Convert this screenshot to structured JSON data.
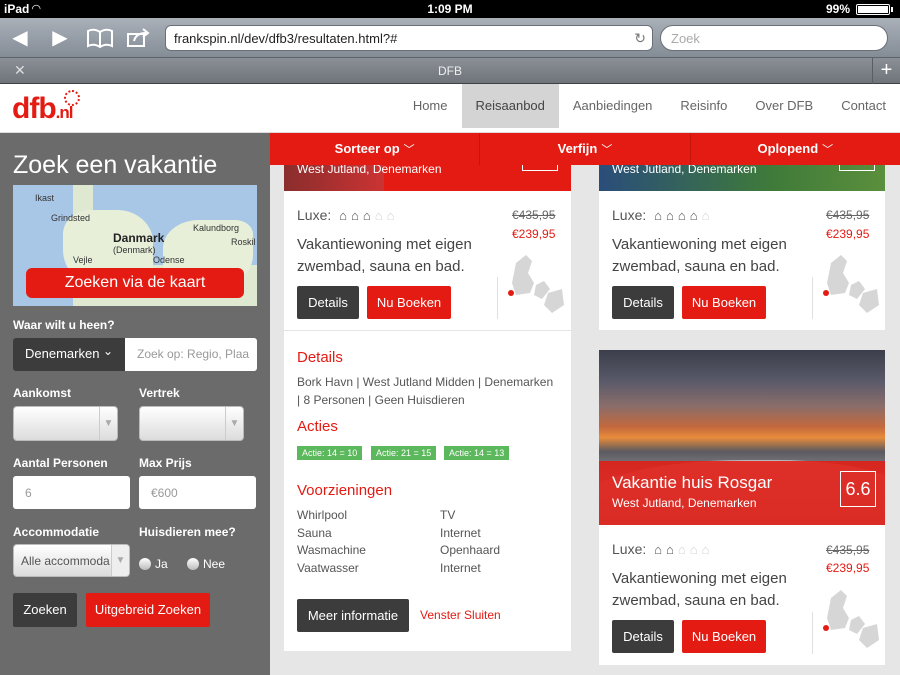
{
  "statusbar": {
    "carrier": "iPad",
    "time": "1:09 PM",
    "battery": "99%"
  },
  "browser": {
    "url": "frankspin.nl/dev/dfb3/resultaten.html?#",
    "search_placeholder": "Zoek",
    "tab_title": "DFB"
  },
  "site": {
    "logo_main": "dfb",
    "logo_tld": ".nl",
    "nav": [
      "Home",
      "Reisaanbod",
      "Aanbiedingen",
      "Reisinfo",
      "Over DFB",
      "Contact"
    ],
    "nav_active": "Reisaanbod"
  },
  "sidebar": {
    "title": "Zoek een vakantie",
    "map_labels": [
      "Grindsted",
      "Danmark",
      "(Denmark)",
      "Kalundborg",
      "Roskil",
      "Vejle",
      "Odense",
      "Ikast"
    ],
    "map_button": "Zoeken via de kaart",
    "where_label": "Waar wilt u heen?",
    "country_value": "Denemarken",
    "region_placeholder": "Zoek op: Regio, Plaa",
    "arrival_label": "Aankomst",
    "departure_label": "Vertrek",
    "persons_label": "Aantal Personen",
    "persons_placeholder": "6",
    "maxprice_label": "Max Prijs",
    "maxprice_placeholder": "€600",
    "accommodation_label": "Accommodatie",
    "accommodation_value": "Alle accommoda",
    "pets_label": "Huisdieren mee?",
    "pets_yes": "Ja",
    "pets_no": "Nee",
    "search_button": "Zoeken",
    "advanced_button": "Uitgebreid Zoeken"
  },
  "filters": [
    "Sorteer op",
    "Verfijn",
    "Oplopend"
  ],
  "cards": {
    "card1": {
      "location": "West Jutland, Denemarken",
      "luxe_label": "Luxe:",
      "luxe_rating": 3,
      "old_price": "€435,95",
      "new_price": "€239,95",
      "desc_line1": "Vakantiewoning met eigen",
      "desc_line2": "zwembad, sauna en bad.",
      "details_button": "Details",
      "book_button": "Nu Boeken",
      "details_title": "Details",
      "details_line1": "Bork Havn | West Jutland Midden | Denemarken",
      "details_line2": "| 8 Personen | Geen Huisdieren",
      "actions_title": "Acties",
      "badges": [
        "Actie: 14 = 10",
        "Actie: 21 = 15",
        "Actie: 14 = 13"
      ],
      "facilities_title": "Voorzieningen",
      "facilities_left": [
        "Whirlpool",
        "Sauna",
        "Wasmachine",
        "Vaatwasser"
      ],
      "facilities_right": [
        "TV",
        "Internet",
        "Openhaard",
        "Internet"
      ],
      "more_button": "Meer informatie",
      "close_link": "Venster Sluiten"
    },
    "card2": {
      "location": "West Jutland, Denemarken",
      "luxe_label": "Luxe:",
      "luxe_rating": 4,
      "old_price": "€435,95",
      "new_price": "€239,95",
      "desc_line1": "Vakantiewoning met eigen",
      "desc_line2": "zwembad, sauna en bad.",
      "details_button": "Details",
      "book_button": "Nu Boeken"
    },
    "card3": {
      "title": "Vakantie huis Rosgar",
      "location": "West Jutland, Denemarken",
      "score": "6.6",
      "luxe_label": "Luxe:",
      "luxe_rating": 2,
      "old_price": "€435,95",
      "new_price": "€239,95",
      "desc_line1": "Vakantiewoning met eigen",
      "desc_line2": "zwembad, sauna en bad.",
      "details_button": "Details",
      "book_button": "Nu Boeken"
    }
  },
  "colors": {
    "brand_red": "#e31b13",
    "sidebar_gray": "#6b6b6b",
    "dark_button": "#3c3c3c",
    "badge_green": "#5cb85c"
  }
}
